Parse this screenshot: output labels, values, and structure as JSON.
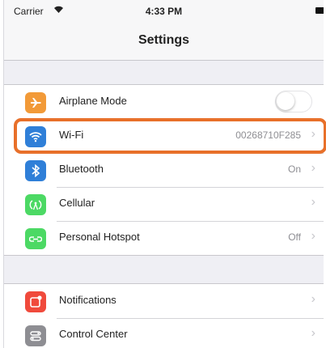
{
  "status_bar": {
    "carrier": "Carrier",
    "time": "4:33 PM"
  },
  "nav": {
    "title": "Settings"
  },
  "colors": {
    "airplane": "#f29a38",
    "wifi": "#2f7fd8",
    "bluetooth": "#2f7fd8",
    "cellular": "#4cd964",
    "hotspot": "#4cd964",
    "notifications": "#f04a3c",
    "control_center": "#8e8e93",
    "highlight": "#e8702a"
  },
  "group1": [
    {
      "label": "Airplane Mode",
      "icon": "airplane-icon",
      "toggle": false
    },
    {
      "label": "Wi-Fi",
      "value": "00268710F285",
      "icon": "wifi-icon",
      "highlighted": true
    },
    {
      "label": "Bluetooth",
      "value": "On",
      "icon": "bluetooth-icon"
    },
    {
      "label": "Cellular",
      "icon": "cellular-icon"
    },
    {
      "label": "Personal Hotspot",
      "value": "Off",
      "icon": "hotspot-icon"
    }
  ],
  "group2": [
    {
      "label": "Notifications",
      "icon": "notifications-icon"
    },
    {
      "label": "Control Center",
      "icon": "control-center-icon"
    }
  ]
}
